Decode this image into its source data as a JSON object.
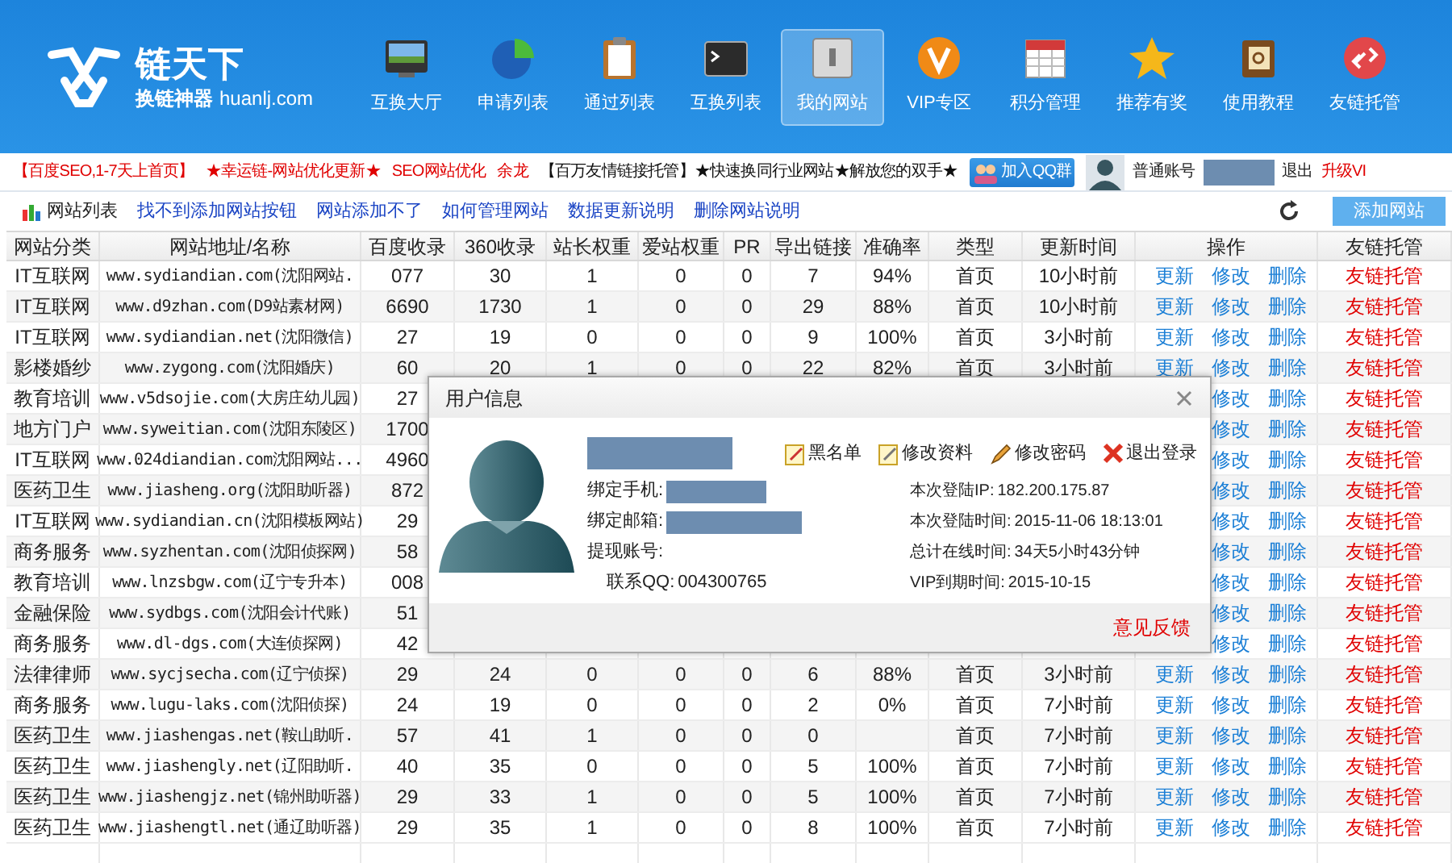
{
  "logo": {
    "title": "链天下",
    "tagline": "换链神器",
    "domain": "huanlj.com"
  },
  "nav": [
    {
      "label": "互换大厅",
      "selected": false
    },
    {
      "label": "申请列表",
      "selected": false
    },
    {
      "label": "通过列表",
      "selected": false
    },
    {
      "label": "互换列表",
      "selected": false
    },
    {
      "label": "我的网站",
      "selected": true
    },
    {
      "label": "VIP专区",
      "selected": false
    },
    {
      "label": "积分管理",
      "selected": false
    },
    {
      "label": "推荐有奖",
      "selected": false
    },
    {
      "label": "使用教程",
      "selected": false
    },
    {
      "label": "友链托管",
      "selected": false
    }
  ],
  "promo_links": [
    {
      "text": "【百度SEO,1-7天上首页】",
      "kind": "promo"
    },
    {
      "text": "★幸运链-网站优化更新★",
      "kind": "promo"
    },
    {
      "text": "SEO网站优化",
      "kind": "promo"
    },
    {
      "text": "余龙",
      "kind": "promo"
    },
    {
      "text": "【百万友情链接托管】★快速换同行业网站★解放您的双手★",
      "kind": "notice"
    }
  ],
  "qq_button": "加入QQ群",
  "account": {
    "type": "普通账号",
    "logout": "退出",
    "upgrade": "升级VI"
  },
  "toolbar": {
    "title": "网站列表",
    "help_links": [
      "找不到添加网站按钮",
      "网站添加不了",
      "如何管理网站",
      "数据更新说明",
      "删除网站说明"
    ],
    "add_button": "添加网站"
  },
  "table": {
    "columns": [
      "网站分类",
      "网站地址/名称",
      "百度收录",
      "360收录",
      "站长权重",
      "爱站权重",
      "PR",
      "导出链接",
      "准确率",
      "类型",
      "更新时间",
      "操作",
      "友链托管"
    ],
    "rows": [
      {
        "category": "IT互联网",
        "site": "www.sydiandian.com(沈阳网站.",
        "baidu": "077",
        "s360": "30",
        "weight": "1",
        "aizhan": "0",
        "pr": "0",
        "outlinks": "7",
        "accuracy": "94%",
        "type": "首页",
        "updated": "10小时前",
        "update": "更新",
        "edit": "修改",
        "delete": "删除",
        "managed": "友链托管"
      },
      {
        "category": "IT互联网",
        "site": "www.d9zhan.com(D9站素材网)",
        "baidu": "6690",
        "s360": "1730",
        "weight": "1",
        "aizhan": "0",
        "pr": "0",
        "outlinks": "29",
        "accuracy": "88%",
        "type": "首页",
        "updated": "10小时前",
        "update": "更新",
        "edit": "修改",
        "delete": "删除",
        "managed": "友链托管"
      },
      {
        "category": "IT互联网",
        "site": "www.sydiandian.net(沈阳微信)",
        "baidu": "27",
        "s360": "19",
        "weight": "0",
        "aizhan": "0",
        "pr": "0",
        "outlinks": "9",
        "accuracy": "100%",
        "type": "首页",
        "updated": "3小时前",
        "update": "更新",
        "edit": "修改",
        "delete": "删除",
        "managed": "友链托管"
      },
      {
        "category": "影楼婚纱",
        "site": "www.zygong.com(沈阳婚庆)",
        "baidu": "60",
        "s360": "20",
        "weight": "1",
        "aizhan": "0",
        "pr": "0",
        "outlinks": "22",
        "accuracy": "82%",
        "type": "首页",
        "updated": "3小时前",
        "update": "更新",
        "edit": "修改",
        "delete": "删除",
        "managed": "友链托管"
      },
      {
        "category": "教育培训",
        "site": "www.v5dsojie.com(大房庄幼儿园)",
        "baidu": "27",
        "edit": "修改",
        "delete": "删除",
        "managed": "友链托管"
      },
      {
        "category": "地方门户",
        "site": "www.syweitian.com(沈阳东陵区)",
        "baidu": "1700",
        "edit": "修改",
        "delete": "删除",
        "managed": "友链托管"
      },
      {
        "category": "IT互联网",
        "site": "www.024diandian.com沈阳网站...",
        "baidu": "4960",
        "edit": "修改",
        "delete": "删除",
        "managed": "友链托管"
      },
      {
        "category": "医药卫生",
        "site": "www.jiasheng.org(沈阳助听器)",
        "baidu": "872",
        "edit": "修改",
        "delete": "删除",
        "managed": "友链托管"
      },
      {
        "category": "IT互联网",
        "site": "www.sydiandian.cn(沈阳模板网站)",
        "baidu": "29",
        "edit": "修改",
        "delete": "删除",
        "managed": "友链托管"
      },
      {
        "category": "商务服务",
        "site": "www.syzhentan.com(沈阳侦探网)",
        "baidu": "58",
        "edit": "修改",
        "delete": "删除",
        "managed": "友链托管"
      },
      {
        "category": "教育培训",
        "site": "www.lnzsbgw.com(辽宁专升本)",
        "baidu": "008",
        "edit": "修改",
        "delete": "删除",
        "managed": "友链托管"
      },
      {
        "category": "金融保险",
        "site": "www.sydbgs.com(沈阳会计代账)",
        "baidu": "51",
        "edit": "修改",
        "delete": "删除",
        "managed": "友链托管"
      },
      {
        "category": "商务服务",
        "site": "www.dl-dgs.com(大连侦探网)",
        "baidu": "42",
        "edit": "修改",
        "delete": "删除",
        "managed": "友链托管"
      },
      {
        "category": "法律律师",
        "site": "www.sycjsecha.com(辽宁侦探)",
        "baidu": "29",
        "s360": "24",
        "weight": "0",
        "aizhan": "0",
        "pr": "0",
        "outlinks": "6",
        "accuracy": "88%",
        "type": "首页",
        "updated": "3小时前",
        "update": "更新",
        "edit": "修改",
        "delete": "删除",
        "managed": "友链托管"
      },
      {
        "category": "商务服务",
        "site": "www.lugu-laks.com(沈阳侦探)",
        "baidu": "24",
        "s360": "19",
        "weight": "0",
        "aizhan": "0",
        "pr": "0",
        "outlinks": "2",
        "accuracy": "0%",
        "type": "首页",
        "updated": "7小时前",
        "update": "更新",
        "edit": "修改",
        "delete": "删除",
        "managed": "友链托管"
      },
      {
        "category": "医药卫生",
        "site": "www.jiashengas.net(鞍山助听.",
        "baidu": "57",
        "s360": "41",
        "weight": "1",
        "aizhan": "0",
        "pr": "0",
        "outlinks": "0",
        "type": "首页",
        "updated": "7小时前",
        "update": "更新",
        "edit": "修改",
        "delete": "删除",
        "managed": "友链托管"
      },
      {
        "category": "医药卫生",
        "site": "www.jiashengly.net(辽阳助听.",
        "baidu": "40",
        "s360": "35",
        "weight": "0",
        "aizhan": "0",
        "pr": "0",
        "outlinks": "5",
        "accuracy": "100%",
        "type": "首页",
        "updated": "7小时前",
        "update": "更新",
        "edit": "修改",
        "delete": "删除",
        "managed": "友链托管"
      },
      {
        "category": "医药卫生",
        "site": "www.jiashengjz.net(锦州助听器)",
        "baidu": "29",
        "s360": "33",
        "weight": "1",
        "aizhan": "0",
        "pr": "0",
        "outlinks": "5",
        "accuracy": "100%",
        "type": "首页",
        "updated": "7小时前",
        "update": "更新",
        "edit": "修改",
        "delete": "删除",
        "managed": "友链托管"
      },
      {
        "category": "医药卫生",
        "site": "www.jiashengtl.net(通辽助听器)",
        "baidu": "29",
        "s360": "35",
        "weight": "1",
        "aizhan": "0",
        "pr": "0",
        "outlinks": "8",
        "accuracy": "100%",
        "type": "首页",
        "updated": "7小时前",
        "update": "更新",
        "edit": "修改",
        "delete": "删除",
        "managed": "友链托管"
      }
    ]
  },
  "dialog": {
    "title": "用户信息",
    "actions": [
      {
        "label": "黑名单",
        "kind": "blacklist"
      },
      {
        "label": "修改资料",
        "kind": "profile"
      },
      {
        "label": "修改密码",
        "kind": "password"
      },
      {
        "label": "退出登录",
        "kind": "logout"
      }
    ],
    "left_fields": [
      {
        "label": "绑定手机:",
        "redacted": true
      },
      {
        "label": "绑定邮箱:",
        "redacted": true
      },
      {
        "label": "提现账号:"
      },
      {
        "label": "联系QQ:",
        "value": "004300765"
      }
    ],
    "right_fields": [
      {
        "label": "本次登陆IP:",
        "value": "182.200.175.87"
      },
      {
        "label": "本次登陆时间:",
        "value": "2015-11-06 18:13:01"
      },
      {
        "label": "总计在线时间:",
        "value": "34天5小时43分钟"
      },
      {
        "label": "VIP到期时间:",
        "value": "2015-10-15"
      }
    ],
    "feedback": "意见反馈"
  }
}
